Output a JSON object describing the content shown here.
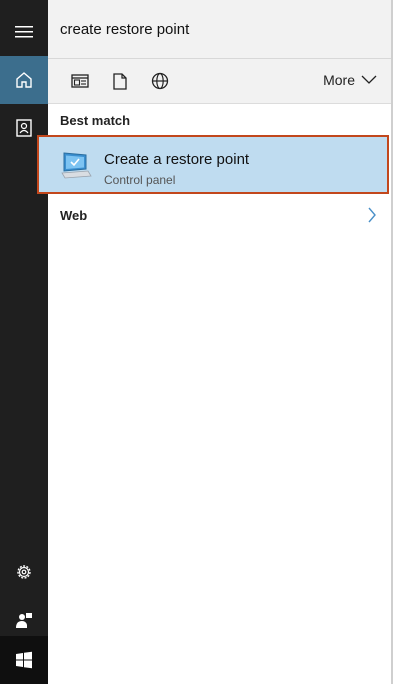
{
  "search": {
    "value": "create restore point"
  },
  "filters": {
    "more_label": "More"
  },
  "sections": {
    "best_match": "Best match",
    "web": "Web"
  },
  "best_result": {
    "title": "Create a restore point",
    "subtitle": "Control panel"
  },
  "sidebar": {
    "items": [
      {
        "name": "hamburger-menu-icon"
      },
      {
        "name": "home-icon"
      },
      {
        "name": "notebook-icon"
      },
      {
        "name": "settings-gear-icon"
      },
      {
        "name": "feedback-icon"
      },
      {
        "name": "windows-start-icon"
      }
    ]
  },
  "colors": {
    "accent": "#3c6e8d",
    "selection": "#bfdcf0",
    "highlight_border": "#c2471c"
  }
}
